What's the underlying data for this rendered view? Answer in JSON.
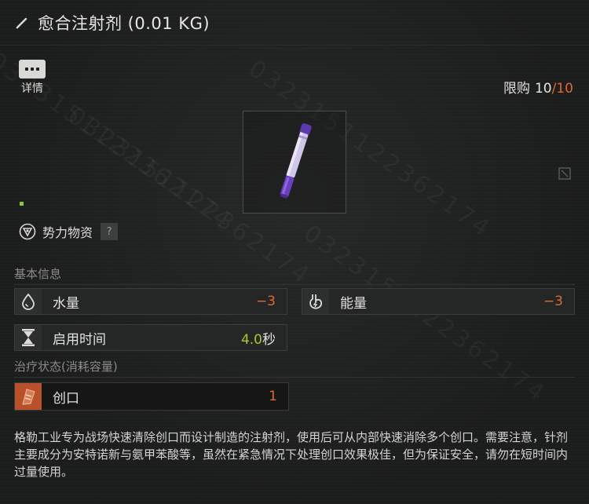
{
  "header": {
    "title": "愈合注射剂 (0.01 KG)",
    "icon": "pen-icon"
  },
  "details_button": {
    "label": "详情",
    "icon": "ellipsis-icon"
  },
  "purchase_limit": {
    "label": "限购",
    "current": "10",
    "separator": "/",
    "max": "10"
  },
  "item": {
    "image": "healing-injector-pen"
  },
  "faction": {
    "label": "势力物资",
    "help": "?"
  },
  "basic_info": {
    "title": "基本信息",
    "water": {
      "label": "水量",
      "value": "−3",
      "icon": "water-drop-icon"
    },
    "energy": {
      "label": "能量",
      "value": "−3",
      "icon": "stomach-icon"
    },
    "use_time": {
      "label": "启用时间",
      "value": "4.0",
      "unit": "秒",
      "icon": "hourglass-icon"
    }
  },
  "treatment": {
    "title": "治疗状态(消耗容量)",
    "wound": {
      "label": "创口",
      "value": "1",
      "icon": "bandage-icon"
    }
  },
  "description": "格勒工业专为战场快速清除创口而设计制造的注射剂，使用后可从内部快速消除多个创口。需要注意，针剂主要成分为安特诺新与氨甲苯酸等，虽然在紧急情况下处理创口效果极佳，但为保证安全，请勿在短时间内过量使用。",
  "watermark": "0323151122362174",
  "colors": {
    "negative": "#e06a2e",
    "positive": "#a6c932",
    "accent_green": "#8ec63f",
    "injector_purple": "#6a3fc0"
  }
}
